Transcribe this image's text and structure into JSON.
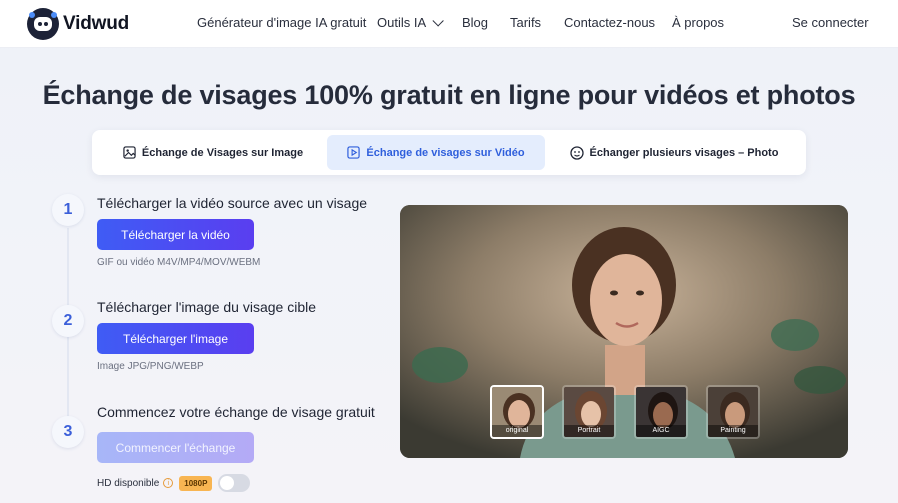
{
  "brand": {
    "name": "Vidwud"
  },
  "nav": {
    "items": [
      {
        "label": "Générateur d'image IA gratuit"
      },
      {
        "label": "Outils IA"
      },
      {
        "label": "Blog"
      },
      {
        "label": "Tarifs"
      },
      {
        "label": "Contactez-nous"
      },
      {
        "label": "À propos"
      }
    ],
    "signin": "Se connecter"
  },
  "hero": {
    "title": "Échange de visages 100% gratuit en ligne pour vidéos et photos"
  },
  "tabs": [
    {
      "label": "Échange de Visages sur Image",
      "icon": "image-icon",
      "active": false
    },
    {
      "label": "Échange de visages sur Vidéo",
      "icon": "video-play-icon",
      "active": true
    },
    {
      "label": "Échanger plusieurs visages – Photo",
      "icon": "multi-face-icon",
      "active": false
    }
  ],
  "steps": [
    {
      "number": "1",
      "title": "Télécharger la vidéo source avec un visage",
      "button": "Télécharger la vidéo",
      "hint": "GIF ou vidéo M4V/MP4/MOV/WEBM"
    },
    {
      "number": "2",
      "title": "Télécharger l'image du visage cible",
      "button": "Télécharger l'image",
      "hint": "Image JPG/PNG/WEBP"
    },
    {
      "number": "3",
      "title": "Commencez votre échange de visage gratuit",
      "button": "Commencer l'échange"
    }
  ],
  "hd": {
    "label": "HD disponible",
    "badge": "1080P",
    "enabled": false
  },
  "preview": {
    "thumbnails": [
      {
        "caption": "original",
        "selected": true
      },
      {
        "caption": "Portrait",
        "selected": false
      },
      {
        "caption": "AIGC",
        "selected": false
      },
      {
        "caption": "Painting",
        "selected": false
      }
    ]
  },
  "colors": {
    "accent": "#3f5cf5",
    "accent2": "#5a3ef0",
    "tab_active_bg": "#e4edfd",
    "badge": "#f8b552"
  }
}
